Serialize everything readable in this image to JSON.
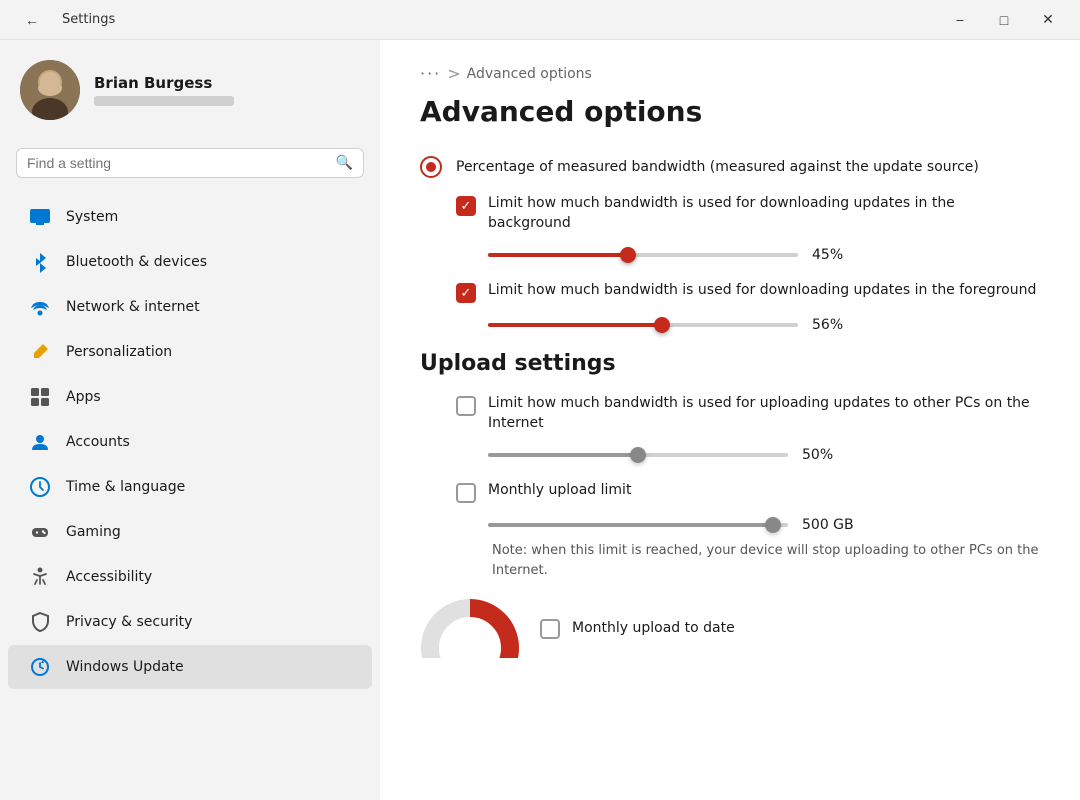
{
  "titlebar": {
    "title": "Settings",
    "back_label": "←",
    "min_label": "−",
    "max_label": "□",
    "close_label": "✕"
  },
  "user": {
    "name": "Brian Burgess",
    "account_placeholder": "●●●●●●●●●●●●"
  },
  "search": {
    "placeholder": "Find a setting"
  },
  "nav": {
    "items": [
      {
        "id": "system",
        "label": "System",
        "icon": "🖥️"
      },
      {
        "id": "bluetooth",
        "label": "Bluetooth & devices",
        "icon": "⬛"
      },
      {
        "id": "network",
        "label": "Network & internet",
        "icon": "📶"
      },
      {
        "id": "personalization",
        "label": "Personalization",
        "icon": "✏️"
      },
      {
        "id": "apps",
        "label": "Apps",
        "icon": "⬛"
      },
      {
        "id": "accounts",
        "label": "Accounts",
        "icon": "👤"
      },
      {
        "id": "time",
        "label": "Time & language",
        "icon": "🌐"
      },
      {
        "id": "gaming",
        "label": "Gaming",
        "icon": "🎮"
      },
      {
        "id": "accessibility",
        "label": "Accessibility",
        "icon": "♿"
      },
      {
        "id": "privacy",
        "label": "Privacy & security",
        "icon": "🛡️"
      },
      {
        "id": "update",
        "label": "Windows Update",
        "icon": "🔄"
      }
    ]
  },
  "main": {
    "breadcrumb_dots": "···",
    "breadcrumb_sep": ">",
    "page_title": "Advanced options",
    "download_section": {
      "radio_label": "Percentage of measured bandwidth (measured against the update source)",
      "bg_checkbox_label": "Limit how much bandwidth is used for downloading updates in the background",
      "bg_slider_pct": 45,
      "bg_slider_value": "45%",
      "fg_checkbox_label": "Limit how much bandwidth is used for downloading updates in the foreground",
      "fg_slider_pct": 56,
      "fg_slider_value": "56%"
    },
    "upload_section": {
      "title": "Upload settings",
      "upload_checkbox_label": "Limit how much bandwidth is used for uploading updates to other PCs on the Internet",
      "upload_slider_pct": 50,
      "upload_slider_value": "50%",
      "monthly_checkbox_label": "Monthly upload limit",
      "monthly_slider_pct": 95,
      "monthly_slider_value": "500 GB",
      "note": "Note: when this limit is reached, your device will stop uploading to other PCs on the Internet.",
      "monthly_to_date_label": "Monthly upload to date"
    }
  }
}
